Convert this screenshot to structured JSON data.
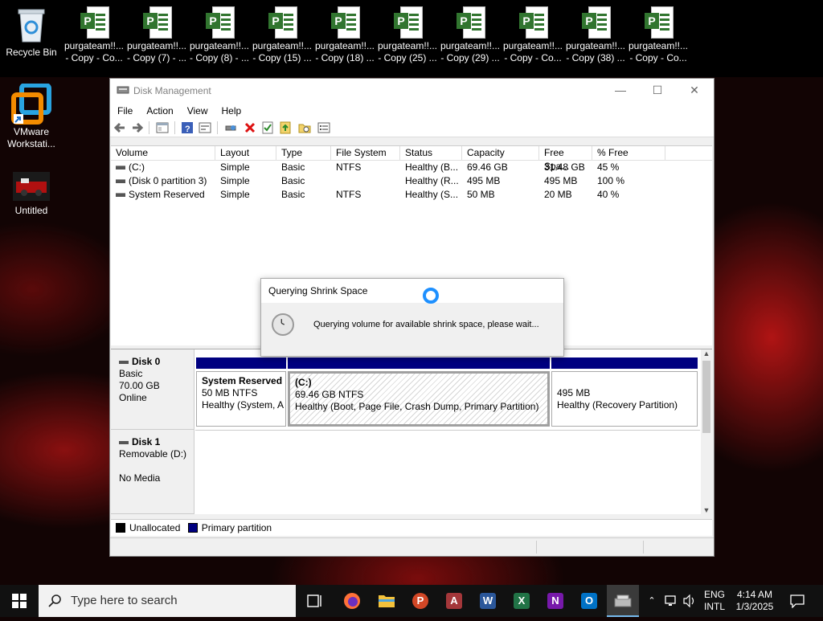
{
  "desktop": {
    "recycle_bin": "Recycle Bin",
    "vmware": [
      "VMware",
      "Workstati..."
    ],
    "untitled": "Untitled",
    "files": [
      {
        "line1": "purgateam!!...",
        "line2": "- Copy - Co..."
      },
      {
        "line1": "purgateam!!...",
        "line2": "- Copy (7) - ..."
      },
      {
        "line1": "purgateam!!...",
        "line2": "- Copy (8) - ..."
      },
      {
        "line1": "purgateam!!...",
        "line2": "- Copy (15) ..."
      },
      {
        "line1": "purgateam!!...",
        "line2": "- Copy (18) ..."
      },
      {
        "line1": "purgateam!!...",
        "line2": "- Copy (25) ..."
      },
      {
        "line1": "purgateam!!...",
        "line2": "- Copy (29) ..."
      },
      {
        "line1": "purgateam!!...",
        "line2": "- Copy - Co..."
      },
      {
        "line1": "purgateam!!...",
        "line2": "- Copy (38) ..."
      },
      {
        "line1": "purgateam!!...",
        "line2": "- Copy - Co..."
      }
    ]
  },
  "window": {
    "title": "Disk Management",
    "menu": [
      "File",
      "Action",
      "View",
      "Help"
    ],
    "columns": [
      "Volume",
      "Layout",
      "Type",
      "File System",
      "Status",
      "Capacity",
      "Free Spa...",
      "% Free"
    ],
    "rows": [
      [
        "(C:)",
        "Simple",
        "Basic",
        "NTFS",
        "Healthy (B...",
        "69.46 GB",
        "31.48 GB",
        "45 %"
      ],
      [
        "(Disk 0 partition 3)",
        "Simple",
        "Basic",
        "",
        "Healthy (R...",
        "495 MB",
        "495 MB",
        "100 %"
      ],
      [
        "System Reserved",
        "Simple",
        "Basic",
        "NTFS",
        "Healthy (S...",
        "50 MB",
        "20 MB",
        "40 %"
      ]
    ],
    "disks": [
      {
        "name": "Disk 0",
        "type": "Basic",
        "size": "70.00 GB",
        "state": "Online"
      },
      {
        "name": "Disk 1",
        "type": "Removable (D:)",
        "size": "",
        "state": "No Media"
      }
    ],
    "partitions": [
      {
        "name": "System Reserved",
        "size": "50 MB NTFS",
        "status": "Healthy (System, A"
      },
      {
        "name": "(C:)",
        "size": "69.46 GB NTFS",
        "status": "Healthy (Boot, Page File, Crash Dump, Primary Partition)"
      },
      {
        "name": "",
        "size": "495 MB",
        "status": "Healthy (Recovery Partition)"
      }
    ],
    "legend": {
      "unallocated": "Unallocated",
      "primary": "Primary partition"
    }
  },
  "dialog": {
    "title": "Querying Shrink Space",
    "message": "Querying volume for available shrink space, please wait..."
  },
  "taskbar": {
    "search_placeholder": "Type here to search",
    "lang1": "ENG",
    "lang2": "INTL",
    "time": "4:14 AM",
    "date": "1/3/2025"
  },
  "colors": {
    "primary_partition": "#000080",
    "accent": "#1e90ff"
  }
}
